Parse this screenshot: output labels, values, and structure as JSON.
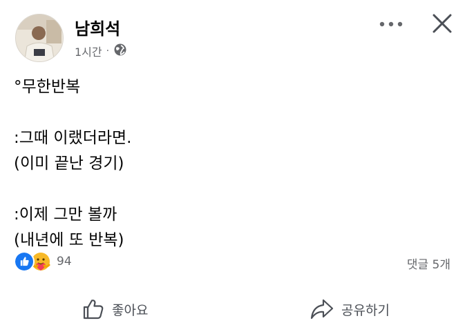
{
  "post": {
    "author": "남희석",
    "time": "1시간",
    "separator": "·",
    "audience_icon": "globe-icon",
    "lines": [
      "°무한반복",
      "",
      ":그때 이랬더라면.",
      "(이미 끝난 경기)",
      "",
      ":이제 그만 볼까",
      "(내년에 또 반복)"
    ]
  },
  "reactions": {
    "icons": [
      "like-reaction-icon",
      "care-reaction-icon"
    ],
    "count": "94",
    "comments": "댓글 5개"
  },
  "actions": {
    "like_label": "좋아요",
    "share_label": "공유하기"
  },
  "colors": {
    "like_blue": "#1877f2",
    "care_yellow": "#f7b928",
    "care_red": "#f33e58",
    "secondary_text": "#65676b"
  }
}
